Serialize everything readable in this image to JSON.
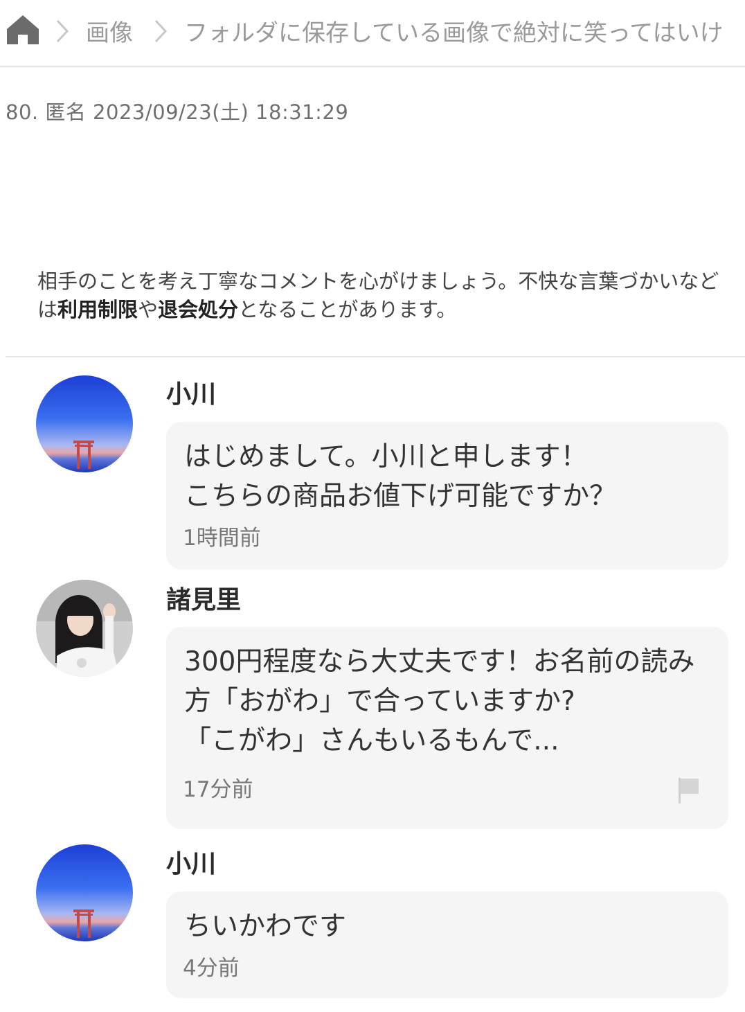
{
  "breadcrumb": {
    "home_icon": "home-icon",
    "separator_icon": "chevron-right-icon",
    "category": "画像",
    "thread_title": "フォルダに保存している画像で絶対に笑ってはいけ"
  },
  "post": {
    "meta": "80. 匿名 2023/09/23(土) 18:31:29"
  },
  "notice": {
    "text_before": "相手のことを考え丁寧なコメントを心がけましょう。不快な言葉づかいなどは",
    "bold_1": "利用制限",
    "text_middle": "や",
    "bold_2": "退会処分",
    "text_after": "となることがあります。"
  },
  "comments": [
    {
      "name": "小川",
      "text": "はじめまして。小川と申します！\nこちらの商品お値下げ可能ですか？",
      "time": "1時間前",
      "avatar": "torii-sunset-avatar"
    },
    {
      "name": "諸見里",
      "text": "300円程度なら大丈夫です！お名前の読み方「おがわ」で合っていますか?\n「こがわ」さんもいるもんで...",
      "time": "17分前",
      "avatar": "person-photo-avatar",
      "flag_icon": "flag-icon"
    },
    {
      "name": "小川",
      "text": "ちいかわです",
      "time": "4分前",
      "avatar": "torii-sunset-avatar"
    }
  ],
  "colors": {
    "bubble_bg": "#f5f5f5",
    "breadcrumb_text": "#9a9a9a",
    "meta_text": "#6f6f6f",
    "divider": "#e3e3e3"
  }
}
